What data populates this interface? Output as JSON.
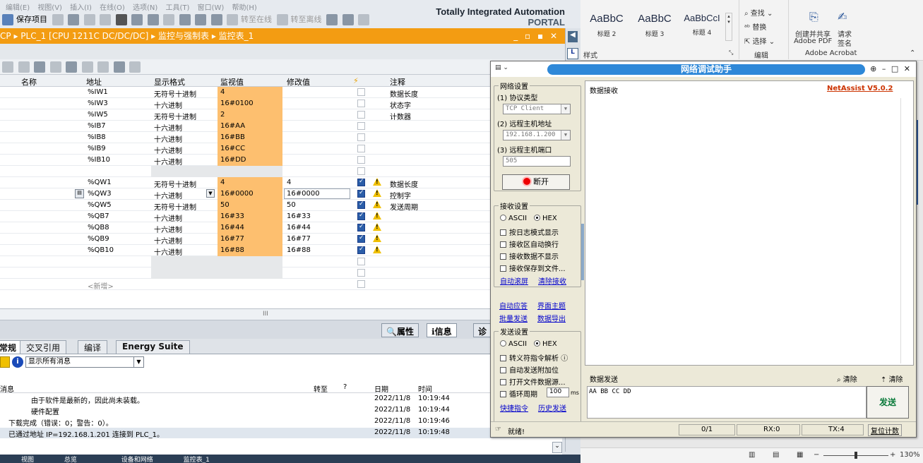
{
  "tia": {
    "menu": [
      "编辑(E)",
      "视图(V)",
      "插入(I)",
      "在线(O)",
      "选项(N)",
      "工具(T)",
      "窗口(W)",
      "帮助(H)"
    ],
    "toolbar": {
      "save": "保存项目",
      "go_online": "转至在线",
      "go_offline": "转至离线"
    },
    "brand_line1": "Totally Integrated Automation",
    "brand_line2": "PORTAL",
    "breadcrumb": {
      "p1": "CP",
      "p2": "PLC_1 [CPU 1211C DC/DC/DC]",
      "p3": "监控与强制表",
      "p4": "监控表_1"
    },
    "table": {
      "headers": {
        "name": "名称",
        "address": "地址",
        "format": "显示格式",
        "monitor": "监视值",
        "modify": "修改值",
        "comment": "注释"
      },
      "rows": [
        {
          "addr": "%IW1",
          "fmt": "无符号十进制",
          "mon": "4",
          "mod": "",
          "chk": false,
          "warn": false,
          "cmt": "数据长度"
        },
        {
          "addr": "%IW3",
          "fmt": "十六进制",
          "mon": "16#0100",
          "mod": "",
          "chk": false,
          "warn": false,
          "cmt": "状态字"
        },
        {
          "addr": "%IW5",
          "fmt": "无符号十进制",
          "mon": "2",
          "mod": "",
          "chk": false,
          "warn": false,
          "cmt": "计数器"
        },
        {
          "addr": "%IB7",
          "fmt": "十六进制",
          "mon": "16#AA",
          "mod": "",
          "chk": false,
          "warn": false,
          "cmt": ""
        },
        {
          "addr": "%IB8",
          "fmt": "十六进制",
          "mon": "16#BB",
          "mod": "",
          "chk": false,
          "warn": false,
          "cmt": ""
        },
        {
          "addr": "%IB9",
          "fmt": "十六进制",
          "mon": "16#CC",
          "mod": "",
          "chk": false,
          "warn": false,
          "cmt": ""
        },
        {
          "addr": "%IB10",
          "fmt": "十六进制",
          "mon": "16#DD",
          "mod": "",
          "chk": false,
          "warn": false,
          "cmt": ""
        },
        {
          "addr": "",
          "fmt": "",
          "mon": "",
          "mod": "",
          "chk": false,
          "warn": false,
          "cmt": "",
          "empty": true
        },
        {
          "addr": "%QW1",
          "fmt": "无符号十进制",
          "mon": "4",
          "mod": "4",
          "chk": true,
          "warn": true,
          "cmt": "数据长度"
        },
        {
          "addr": "%QW3",
          "fmt": "十六进制",
          "mon": "16#0000",
          "mod": "16#0000",
          "chk": true,
          "warn": true,
          "cmt": "控制字",
          "editing": true
        },
        {
          "addr": "%QW5",
          "fmt": "无符号十进制",
          "mon": "50",
          "mod": "50",
          "chk": true,
          "warn": true,
          "cmt": "发送周期"
        },
        {
          "addr": "%QB7",
          "fmt": "十六进制",
          "mon": "16#33",
          "mod": "16#33",
          "chk": true,
          "warn": true,
          "cmt": ""
        },
        {
          "addr": "%QB8",
          "fmt": "十六进制",
          "mon": "16#44",
          "mod": "16#44",
          "chk": true,
          "warn": true,
          "cmt": ""
        },
        {
          "addr": "%QB9",
          "fmt": "十六进制",
          "mon": "16#77",
          "mod": "16#77",
          "chk": true,
          "warn": true,
          "cmt": ""
        },
        {
          "addr": "%QB10",
          "fmt": "十六进制",
          "mon": "16#88",
          "mod": "16#88",
          "chk": true,
          "warn": true,
          "cmt": ""
        },
        {
          "addr": "",
          "fmt": "",
          "mon": "",
          "mod": "",
          "chk": false,
          "warn": false,
          "cmt": "",
          "empty": true
        },
        {
          "addr": "",
          "fmt": "",
          "mon": "",
          "mod": "",
          "chk": false,
          "warn": false,
          "cmt": "",
          "empty": true
        },
        {
          "addr": "<新增>",
          "fmt": "",
          "mon": "",
          "mod": "",
          "chk": false,
          "warn": false,
          "cmt": "",
          "add": true
        }
      ]
    },
    "inspector_tabs": {
      "props": "属性",
      "info": "信息",
      "diag": "诊"
    },
    "sub_tabs": {
      "general": "常规",
      "xref": "交叉引用",
      "compile": "编译",
      "energy": "Energy Suite"
    },
    "filter": "显示所有消息",
    "msg_headers": {
      "msg": "消息",
      "goto": "转至",
      "q": "?",
      "date": "日期",
      "time": "时间"
    },
    "messages": [
      {
        "text": "由于软件是最新的，因此尚未装载。",
        "date": "2022/11/8",
        "time": "10:19:44",
        "indent": 2
      },
      {
        "text": "硬件配置",
        "date": "2022/11/8",
        "time": "10:19:44",
        "indent": 2
      },
      {
        "text": "下载完成（错误：0；警告：0）。",
        "date": "2022/11/8",
        "time": "10:19:46",
        "indent": 1
      },
      {
        "text": "已通过地址 IP=192.168.1.201 连接到 PLC_1。",
        "date": "2022/11/8",
        "time": "10:19:48",
        "indent": 1
      }
    ],
    "taskbar": [
      "视图",
      "总览",
      "设备和网络",
      "监控表_1"
    ]
  },
  "word": {
    "styles": [
      {
        "sample": "AaBbC",
        "cap": "标题 2"
      },
      {
        "sample": "AaBbC",
        "cap": "标题 3"
      },
      {
        "sample": "AaBbCcI",
        "cap": "标题 4"
      }
    ],
    "find": "查找",
    "replace": "替换",
    "select": "选择",
    "edit_group": "编辑",
    "pdf_create": "创建并共享",
    "pdf_sub": "Adobe PDF",
    "sign_req": "请求",
    "sign_sub": "签名",
    "acrobat_group": "Adobe Acrobat",
    "styles_group": "样式",
    "zoom": "130%"
  },
  "netassist": {
    "title": "网络调试助手",
    "version": "NetAssist V5.0.2",
    "net_settings": "网络设置",
    "proto_label": "(1) 协议类型",
    "proto_value": "TCP Client",
    "host_label": "(2) 远程主机地址",
    "host_value": "192.168.1.200",
    "port_label": "(3) 远程主机端口",
    "port_value": "505",
    "disconnect": "断开",
    "recv_settings": "接收设置",
    "ascii": "ASCII",
    "hex": "HEX",
    "recv_opts": [
      "按日志模式显示",
      "接收区自动换行",
      "接收数据不显示",
      "接收保存到文件..."
    ],
    "auto_scroll": "自动滚屏",
    "clear_recv": "清除接收",
    "auto_reply": "自动应答",
    "ui_theme": "界面主题",
    "batch_send": "批量发送",
    "export": "数据导出",
    "send_settings": "发送设置",
    "send_opts": [
      "转义符指令解析",
      "自动发送附加位",
      "打开文件数据源..."
    ],
    "loop_label": "循环周期",
    "loop_value": "100",
    "loop_unit": "ms",
    "quick_cmd": "快捷指令",
    "history": "历史发送",
    "recv_label": "数据接收",
    "send_label": "数据发送",
    "clear1": "清除",
    "clear2": "清除",
    "send_text": "AA BB CC DD",
    "send_btn": "发送",
    "status": "就绪!",
    "count": "0/1",
    "rx": "RX:0",
    "tx": "TX:4",
    "reset": "复位计数"
  }
}
